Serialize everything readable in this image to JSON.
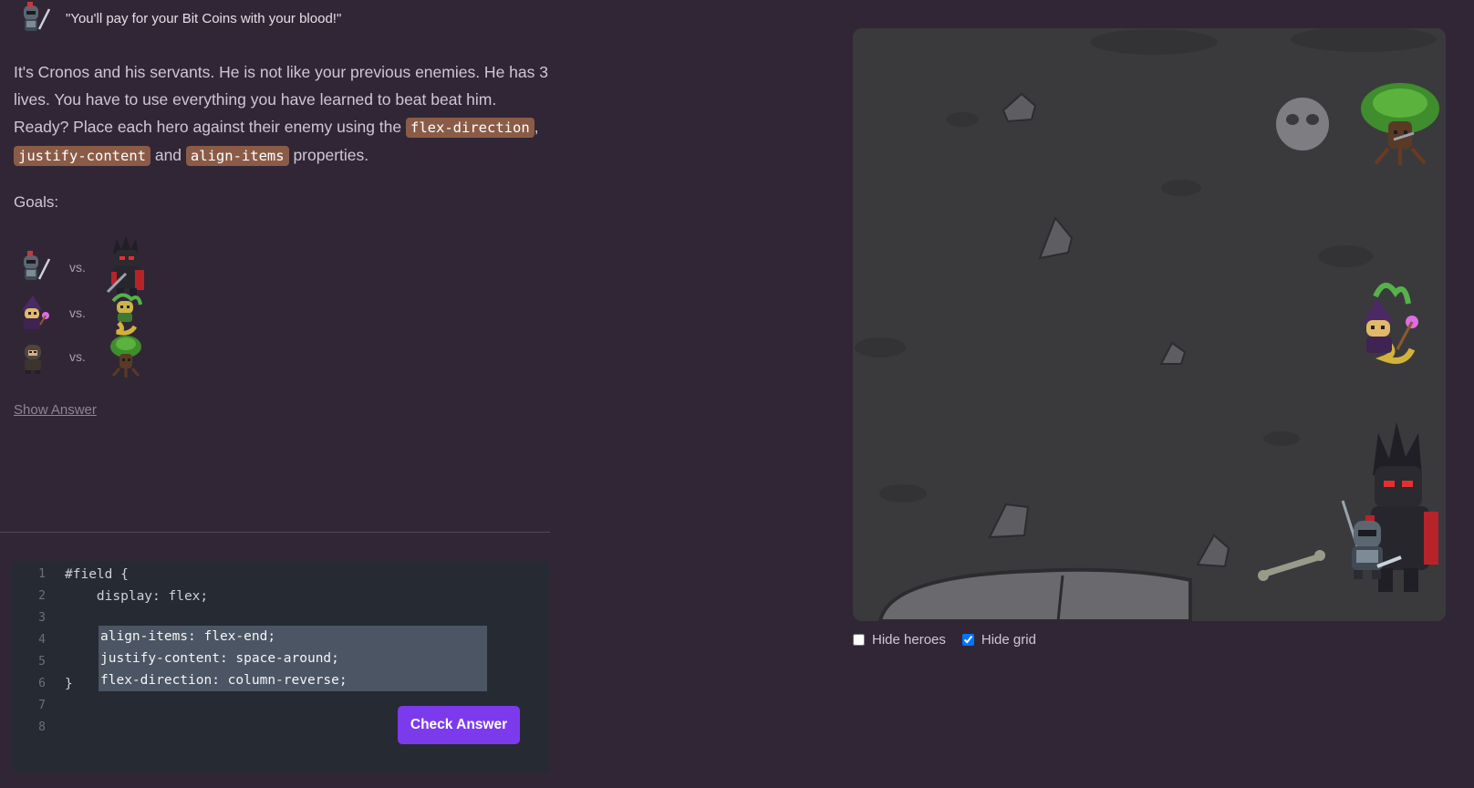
{
  "quote": {
    "text": "\"You'll pay for your Bit Coins with your blood!\""
  },
  "description": {
    "part1": "It's Cronos and his servants. He is not like your previous enemies. He has 3 lives. You have to use everything you have learned to beat beat him. Ready? Place each hero against their enemy using the ",
    "prop1": "flex-direction",
    "part2": ", ",
    "prop2": "justify-content",
    "part3": " and ",
    "prop3": "align-items",
    "part4": " properties."
  },
  "goals": {
    "label": "Goals:",
    "vs_label": "vs.",
    "pairs": [
      {
        "hero": "knight",
        "enemy": "cronos"
      },
      {
        "hero": "wizard",
        "enemy": "medusa"
      },
      {
        "hero": "ranger",
        "enemy": "treant"
      }
    ]
  },
  "show_answer": "Show Answer",
  "editor": {
    "line_numbers": [
      "1",
      "2",
      "3",
      "4",
      "5",
      "6",
      "7",
      "8"
    ],
    "line1": "#field {",
    "line2": "    display: flex;",
    "input_value": "align-items: flex-end;\njustify-content: space-around;\nflex-direction: column-reverse;",
    "line6": "}",
    "check_button": "Check Answer"
  },
  "options": {
    "hide_heroes": {
      "label": "Hide heroes",
      "checked": false
    },
    "hide_grid": {
      "label": "Hide grid",
      "checked": true
    }
  },
  "colors": {
    "background": "#312636",
    "accent": "#7c3aed",
    "code_tag": "#8a5c47",
    "editor_bg": "#262a33",
    "field_bg": "#3a3a3d"
  }
}
